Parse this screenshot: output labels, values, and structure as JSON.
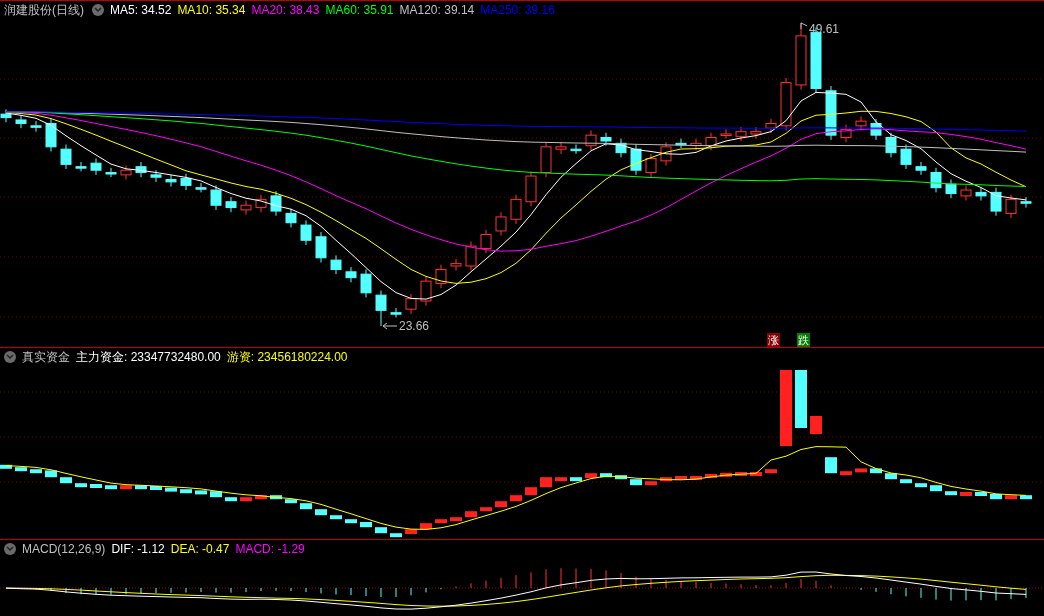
{
  "price_panel": {
    "title": "润建股份(日线)",
    "ma_lines": [
      {
        "text": "MA5: 34.52",
        "color": "#ffffff"
      },
      {
        "text": "MA10: 35.34",
        "color": "#ffff00"
      },
      {
        "text": "MA20: 38.43",
        "color": "#ff00ff"
      },
      {
        "text": "MA60: 35.91",
        "color": "#00ff00"
      },
      {
        "text": "MA120: 39.14",
        "color": "#c0c0c0"
      },
      {
        "text": "MA250: 39.16",
        "color": "#0000ff"
      }
    ],
    "high_label": "49.61",
    "low_label": "23.66",
    "markers": [
      {
        "text": "涨",
        "kind": "rise"
      },
      {
        "text": "跌",
        "kind": "fall"
      }
    ]
  },
  "fund_panel": {
    "title": "真实资金",
    "items": [
      {
        "text": "主力资金: 23347732480.00",
        "color": "#ffffff"
      },
      {
        "text": "游资: 23456180224.00",
        "color": "#ffff00"
      }
    ]
  },
  "macd_panel": {
    "title": "MACD(12,26,9)",
    "items": [
      {
        "text": "DIF: -1.12",
        "color": "#ffffff"
      },
      {
        "text": "DEA: -0.47",
        "color": "#ffff00"
      },
      {
        "text": "MACD: -1.29",
        "color": "#ff00ff"
      }
    ]
  }
}
